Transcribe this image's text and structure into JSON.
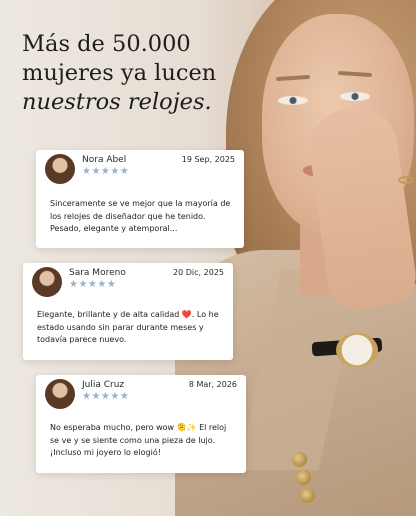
{
  "headline": {
    "line1": "Más de 50.000",
    "line2": "mujeres ya lucen",
    "line3": "nuestros relojes."
  },
  "reviews": [
    {
      "name": "Nora Abel",
      "date": "19 Sep, 2025",
      "rating": 5,
      "stars": "★★★★★",
      "text": "Sinceramente se ve mejor que la mayoría de los relojes de diseñador que he tenido. Pesado, elegante y atemporal..."
    },
    {
      "name": "Sara Moreno",
      "date": "20 Dic, 2025",
      "rating": 5,
      "stars": "★★★★★",
      "text": "Elegante, brillante y de alta calidad ❤️. Lo he estado usando sin parar durante meses y todavía parece nuevo."
    },
    {
      "name": "Julia Cruz",
      "date": "8 Mar, 2026",
      "rating": 5,
      "stars": "★★★★★",
      "text": "No esperaba mucho, pero wow 🫠✨ El reloj se ve y se siente como una pieza de lujo. ¡Incluso mi joyero lo elogió!"
    }
  ],
  "colors": {
    "star": "#9db0c7",
    "headline": "#1d1d1d",
    "card_bg": "#ffffff"
  }
}
